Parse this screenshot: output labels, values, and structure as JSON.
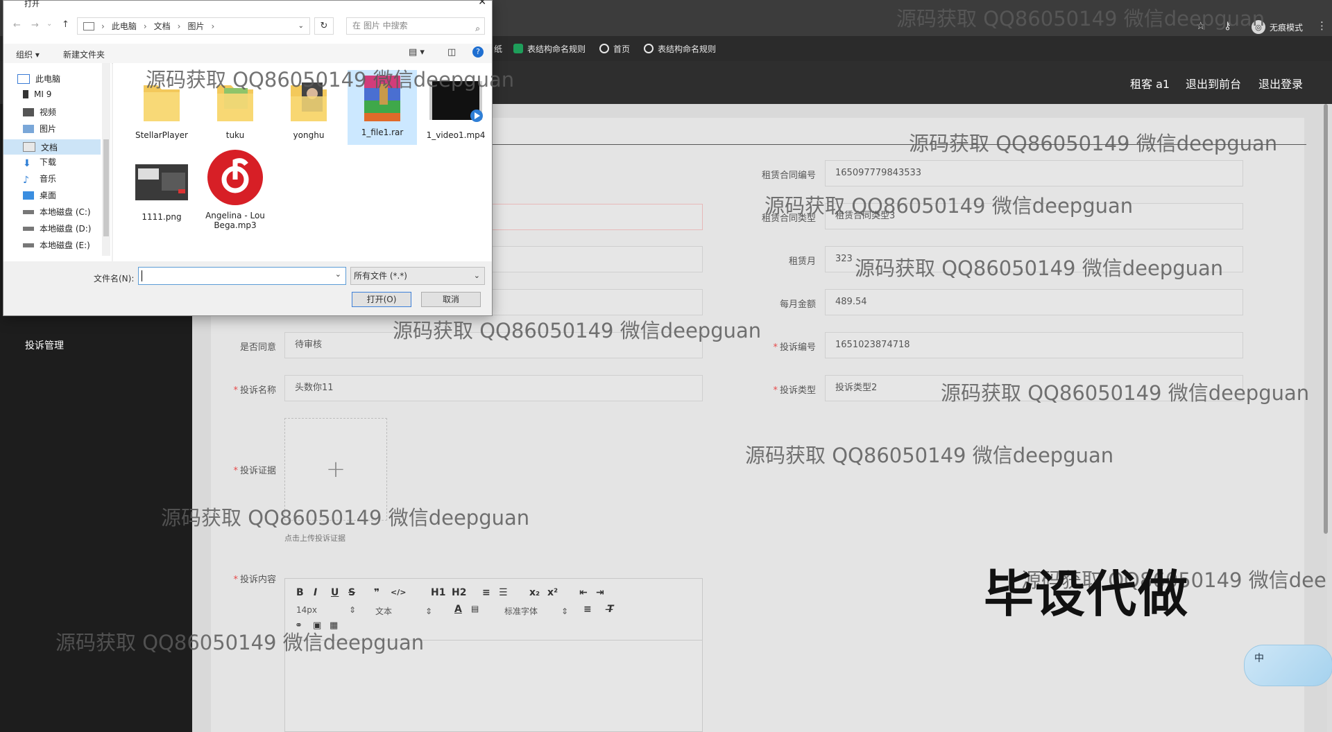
{
  "browser": {
    "bookmarks": [
      {
        "label": "纸"
      },
      {
        "label": "表结构命名规则",
        "icon": "sheets-icon"
      },
      {
        "label": "首页",
        "icon": "globe-icon"
      },
      {
        "label": "表结构命名规则",
        "icon": "globe-icon"
      }
    ],
    "incognito_label": "无痕模式"
  },
  "header": {
    "user": "租客 a1",
    "back_front": "退出到前台",
    "logout": "退出登录"
  },
  "sidebar": {
    "complaint": "投诉管理"
  },
  "form": {
    "contract_no_label": "租赁合同编号",
    "contract_no": "165097779843533",
    "contract_type_label": "租赁合同类型",
    "contract_type": "租赁合同类型3",
    "lease_months_label": "租赁月",
    "lease_months": "323",
    "monthly_amount_label": "每月金额",
    "monthly_amount": "489.54",
    "agree_label": "是否同意",
    "agree": "待审核",
    "complaint_no_label": "投诉编号",
    "complaint_no": "1651023874718",
    "complaint_name_label": "投诉名称",
    "complaint_name": "头数你11",
    "complaint_type_label": "投诉类型",
    "complaint_type": "投诉类型2",
    "evidence_label": "投诉证据",
    "upload_hint": "点击上传投诉证据",
    "content_label": "投诉内容"
  },
  "editor": {
    "font_size": "14px",
    "block": "文本",
    "font": "标准字体",
    "buttons": [
      "B",
      "I",
      "U",
      "S",
      "❞",
      "</>",
      "H1",
      "H2",
      "≡",
      "☰",
      "x₂",
      "x²",
      "⇤",
      "⇥"
    ]
  },
  "dialog": {
    "title": "打开",
    "breadcrumb": [
      "此电脑",
      "文档",
      "图片"
    ],
    "search_placeholder": "在 图片 中搜索",
    "organize": "组织 ▾",
    "new_folder": "新建文件夹",
    "nav": [
      "此电脑",
      "MI 9",
      "视频",
      "图片",
      "文档",
      "下载",
      "音乐",
      "桌面",
      "本地磁盘 (C:)",
      "本地磁盘 (D:)",
      "本地磁盘 (E:)"
    ],
    "files": [
      {
        "name": "StellarPlayer",
        "kind": "folder"
      },
      {
        "name": "tuku",
        "kind": "folder"
      },
      {
        "name": "yonghu",
        "kind": "folder"
      },
      {
        "name": "1_file1.rar",
        "kind": "archive"
      },
      {
        "name": "1_video1.mp4",
        "kind": "video"
      },
      {
        "name": "1111.png",
        "kind": "image"
      },
      {
        "name": "Angelina - Lou Bega.mp3",
        "kind": "audio"
      }
    ],
    "filename_label": "文件名(N):",
    "filetype": "所有文件 (*.*)",
    "open": "打开(O)",
    "cancel": "取消"
  },
  "overlay": {
    "watermark": "源码获取 QQ86050149 微信deepguan",
    "watermark_partial": "源码获取 QQ86050149 微信dee",
    "stamp": "毕设代做",
    "ime": "中"
  },
  "colors": {
    "required": "#e64a4a",
    "accent": "#5b9bd5",
    "netease_red": "#d71f26"
  }
}
